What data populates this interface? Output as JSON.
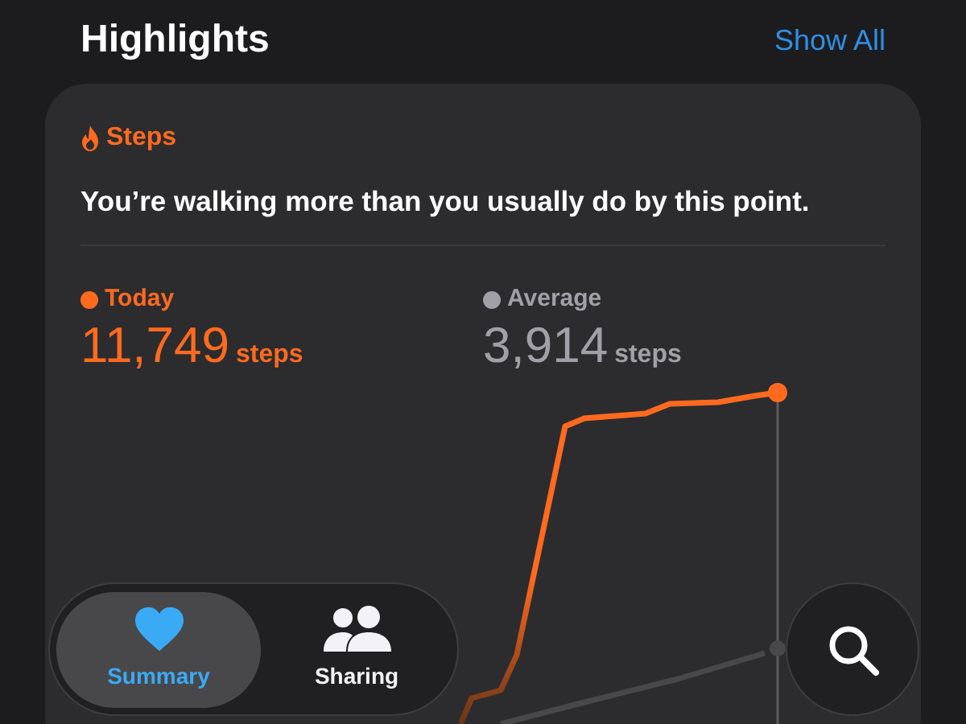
{
  "header": {
    "title": "Highlights",
    "action": "Show All"
  },
  "card": {
    "category": "Steps",
    "message": "You’re walking more than you usually do by this point.",
    "stats": [
      {
        "kind": "today",
        "label": "Today",
        "value": "11,749",
        "unit": "steps"
      },
      {
        "kind": "average",
        "label": "Average",
        "value": "3,914",
        "unit": "steps"
      }
    ]
  },
  "tab_bar": {
    "tabs": [
      {
        "kind": "summary",
        "label": "Summary",
        "selected": true
      },
      {
        "kind": "sharing",
        "label": "Sharing",
        "selected": false
      }
    ]
  }
}
